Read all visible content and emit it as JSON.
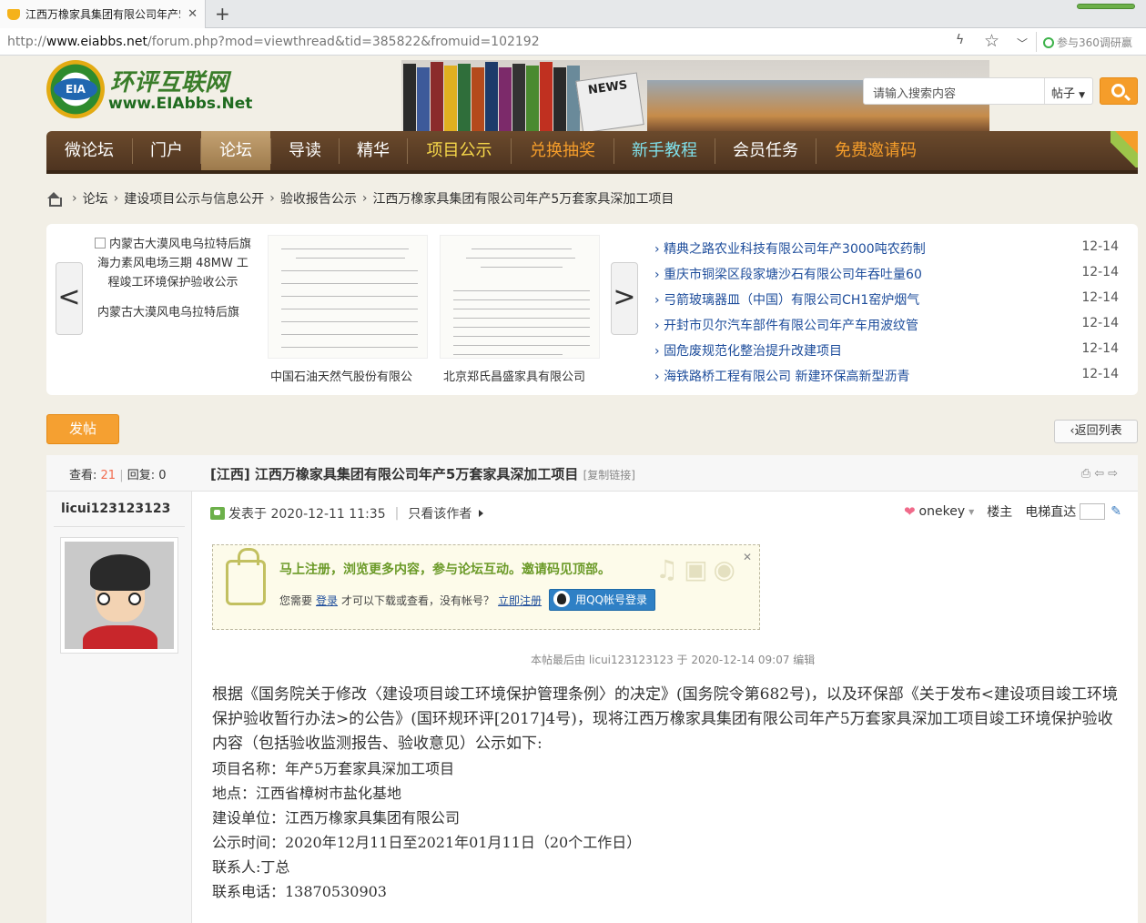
{
  "browser": {
    "tab_title": "江西万橡家具集团有限公司年产5",
    "url_prefix": "http://",
    "url_domain": "www.eiabbs.net",
    "url_path": "/forum.php?mod=viewthread&tid=385822&fromuid=102192",
    "search_hint": "参与360调研赢"
  },
  "logo": {
    "cn": "环评互联网",
    "en": "www.EIAbbs.Net",
    "badge": "EIA"
  },
  "banner": {
    "news_label": "NEWS"
  },
  "search": {
    "placeholder": "请输入搜索内容",
    "scope": "帖子"
  },
  "nav": [
    "微论坛",
    "门户",
    "论坛",
    "导读",
    "精华",
    "项目公示",
    "兑换抽奖",
    "新手教程",
    "会员任务",
    "免费邀请码"
  ],
  "nav_colors": {
    "yellow": "#f7d84a",
    "orange": "#f59d2a",
    "cyan": "#7fe0ea"
  },
  "breadcrumb": [
    "论坛",
    "建设项目公示与信息公开",
    "验收报告公示",
    "江西万橡家具集团有限公司年产5万套家具深加工项目"
  ],
  "slider": {
    "items": [
      {
        "alt": "内蒙古大漠风电乌拉特后旗海力素风电场三期 48MW 工程竣工环境保护验收公示",
        "caption": "内蒙古大漠风电乌拉特后旗"
      },
      {
        "caption": "中国石油天然气股份有限公"
      },
      {
        "caption": "北京郑氏昌盛家具有限公司"
      }
    ]
  },
  "news": [
    {
      "title": "精典之路农业科技有限公司年产3000吨农药制",
      "date": "12-14"
    },
    {
      "title": "重庆市铜梁区段家塘沙石有限公司年吞吐量60",
      "date": "12-14"
    },
    {
      "title": "弓箭玻璃器皿（中国）有限公司CH1窑炉烟气",
      "date": "12-14"
    },
    {
      "title": "开封市贝尔汽车部件有限公司年产车用波纹管",
      "date": "12-14"
    },
    {
      "title": "固危废规范化整治提升改建项目",
      "date": "12-14"
    },
    {
      "title": "海铁路桥工程有限公司 新建环保高新型沥青",
      "date": "12-14"
    }
  ],
  "actions": {
    "post": "发帖",
    "back": "返回列表"
  },
  "thread": {
    "views_label": "查看:",
    "views": "21",
    "replies_label": "回复:",
    "replies": "0",
    "title": "[江西] 江西万橡家具集团有限公司年产5万套家具深加工项目",
    "copy_link": "[复制链接]"
  },
  "post": {
    "author": "licui123123123",
    "posted": "发表于 2020-12-11 11:35",
    "only_author": "只看该作者",
    "onekey": "onekey",
    "floor": "楼主",
    "elevator": "电梯直达",
    "edited": "本帖最后由 licui123123123 于 2020-12-14 09:07 编辑"
  },
  "notice": {
    "title": "马上注册，浏览更多内容，参与论坛互动。邀请码见顶部。",
    "need": "您需要",
    "login": "登录",
    "mid": "才可以下载或查看，没有帐号？",
    "register": "立即注册",
    "qq": "用QQ帐号登录"
  },
  "content": {
    "intro": "根据《国务院关于修改〈建设项目竣工环境保护管理条例〉的决定》(国务院令第682号)，以及环保部《关于发布<建设项目竣工环境保护验收暂行办法>的公告》(国环规环评[2017]4号)，现将江西万橡家具集团有限公司年产5万套家具深加工项目竣工环境保护验收内容（包括验收监测报告、验收意见）公示如下:",
    "lines": [
      "项目名称：年产5万套家具深加工项目",
      "地点：江西省樟树市盐化基地",
      "建设单位：江西万橡家具集团有限公司",
      "公示时间：2020年12月11日至2021年01月11日（20个工作日）",
      "联系人:丁总",
      "联系电话：13870530903"
    ]
  }
}
